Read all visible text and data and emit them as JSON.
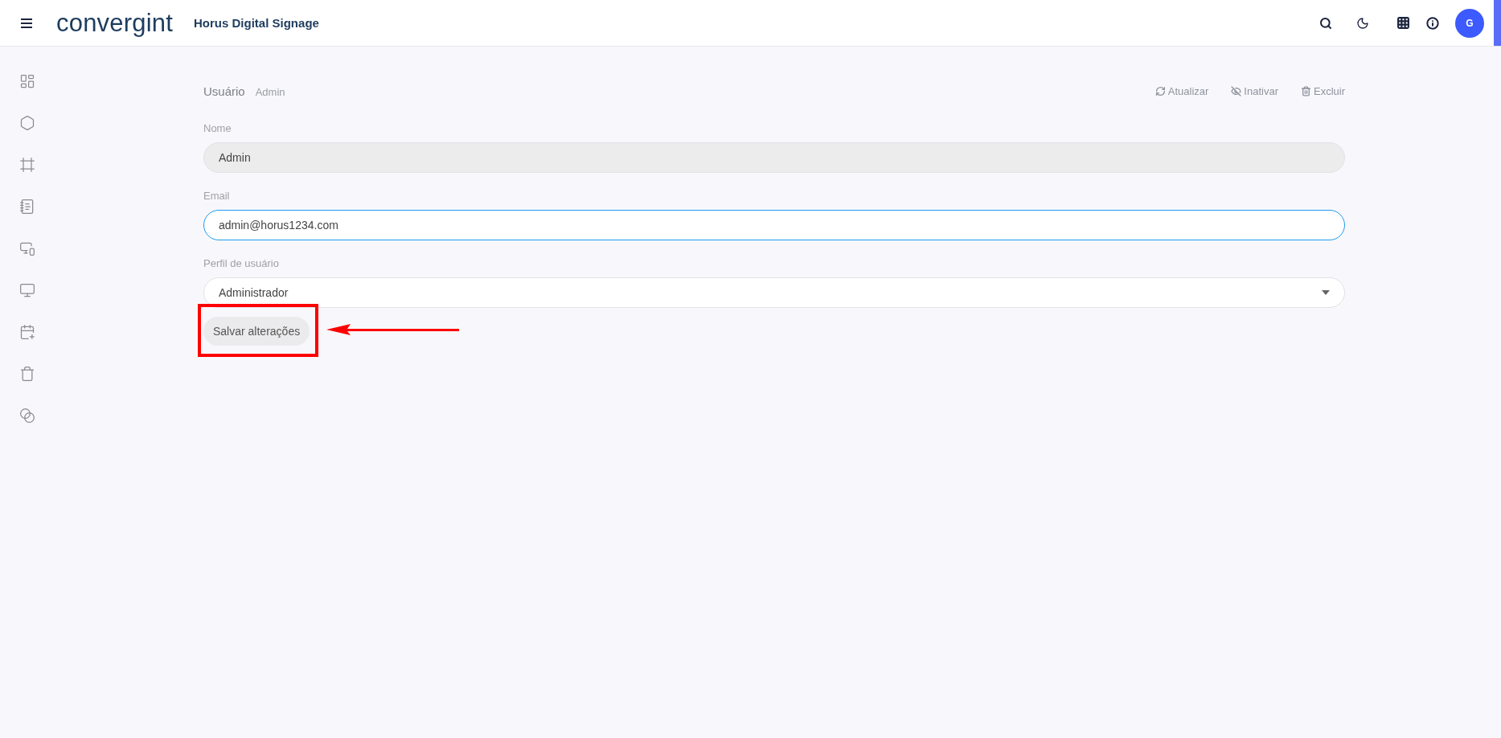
{
  "header": {
    "logo": "convergint",
    "app_title": "Horus Digital Signage",
    "avatar": "G"
  },
  "sidebar": {
    "items": [
      {
        "kind": "dashboard"
      },
      {
        "kind": "hexagon"
      },
      {
        "kind": "frame"
      },
      {
        "kind": "notebook"
      },
      {
        "kind": "devices"
      },
      {
        "kind": "screens"
      },
      {
        "kind": "calendar"
      },
      {
        "kind": "trash"
      },
      {
        "kind": "overlap"
      }
    ]
  },
  "page": {
    "title": "Usuário",
    "subtitle": "Admin",
    "actions": [
      {
        "kind": "refresh",
        "label": "Atualizar"
      },
      {
        "kind": "hide",
        "label": "Inativar"
      },
      {
        "kind": "delete",
        "label": "Excluir"
      }
    ],
    "fields": [
      {
        "kind": "text",
        "label": "Nome",
        "value": "Admin",
        "disabled": true,
        "focused": false
      },
      {
        "kind": "text",
        "label": "Email",
        "value": "admin@horus1234.com",
        "disabled": false,
        "focused": true
      },
      {
        "kind": "select",
        "label": "Perfil de usuário",
        "value": "Administrador",
        "disabled": false,
        "focused": false
      }
    ],
    "save_button": "Salvar alterações",
    "annotation": {
      "highlighted": true
    }
  }
}
